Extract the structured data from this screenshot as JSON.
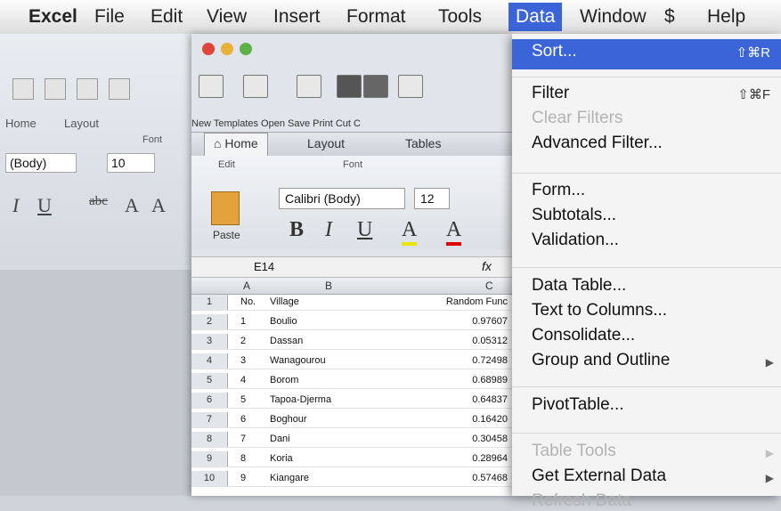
{
  "menubar": {
    "items": [
      "Excel",
      "File",
      "Edit",
      "View",
      "Insert",
      "Format",
      "Tools",
      "Data",
      "Window",
      "$",
      "Help"
    ],
    "active_index": 7,
    "accent_color": "#3a64d8"
  },
  "back_window": {
    "tabs": [
      "Home",
      "Layout"
    ],
    "group_label": "Font",
    "font_name": "(Body)",
    "font_size": "10"
  },
  "front_window": {
    "toolbar_labels": "New Templates Open Save Print Cut C",
    "tabs": [
      "Home",
      "Layout",
      "Tables"
    ],
    "edit_label": "Edit",
    "font_label": "Font",
    "paste_label": "Paste",
    "font_name": "Calibri (Body)",
    "font_size": "12",
    "cell_ref": "E14",
    "fx": "fx",
    "columns": [
      "A",
      "B",
      "C"
    ],
    "rows": [
      {
        "n": "1",
        "a": "No.",
        "b": "Village",
        "c": "Random Func"
      },
      {
        "n": "2",
        "a": "1",
        "b": "Boulio",
        "c": "0.97607"
      },
      {
        "n": "3",
        "a": "2",
        "b": "Dassan",
        "c": "0.05312"
      },
      {
        "n": "4",
        "a": "3",
        "b": "Wanagourou",
        "c": "0.72498"
      },
      {
        "n": "5",
        "a": "4",
        "b": "Borom",
        "c": "0.68989"
      },
      {
        "n": "6",
        "a": "5",
        "b": "Tapoa-Djerma",
        "c": "0.64837"
      },
      {
        "n": "7",
        "a": "6",
        "b": "Boghour",
        "c": "0.16420"
      },
      {
        "n": "8",
        "a": "7",
        "b": "Dani",
        "c": "0.30458"
      },
      {
        "n": "9",
        "a": "8",
        "b": "Koria",
        "c": "0.28964"
      },
      {
        "n": "10",
        "a": "9",
        "b": "Kiangare",
        "c": "0.57468"
      }
    ]
  },
  "data_menu": {
    "items": [
      {
        "label": "Sort...",
        "shortcut": "⇧⌘R",
        "selected": true,
        "disabled": false
      },
      {
        "label": "Filter",
        "shortcut": "⇧⌘F",
        "selected": false,
        "disabled": false
      },
      {
        "label": "Clear Filters",
        "shortcut": "",
        "selected": false,
        "disabled": true
      },
      {
        "label": "Advanced Filter...",
        "shortcut": "",
        "selected": false,
        "disabled": false
      },
      {
        "label": "Form...",
        "shortcut": "",
        "selected": false,
        "disabled": false
      },
      {
        "label": "Subtotals...",
        "shortcut": "",
        "selected": false,
        "disabled": false
      },
      {
        "label": "Validation...",
        "shortcut": "",
        "selected": false,
        "disabled": false
      },
      {
        "label": "Data Table...",
        "shortcut": "",
        "selected": false,
        "disabled": false
      },
      {
        "label": "Text to Columns...",
        "shortcut": "",
        "selected": false,
        "disabled": false
      },
      {
        "label": "Consolidate...",
        "shortcut": "",
        "selected": false,
        "disabled": false
      },
      {
        "label": "Group and Outline",
        "shortcut": "",
        "submenu": true,
        "selected": false,
        "disabled": false
      },
      {
        "label": "PivotTable...",
        "shortcut": "",
        "selected": false,
        "disabled": false
      },
      {
        "label": "Table Tools",
        "shortcut": "",
        "submenu": true,
        "selected": false,
        "disabled": true
      },
      {
        "label": "Get External Data",
        "shortcut": "",
        "submenu": true,
        "selected": false,
        "disabled": false
      },
      {
        "label": "Refresh Data",
        "shortcut": "",
        "selected": false,
        "disabled": true
      }
    ]
  }
}
